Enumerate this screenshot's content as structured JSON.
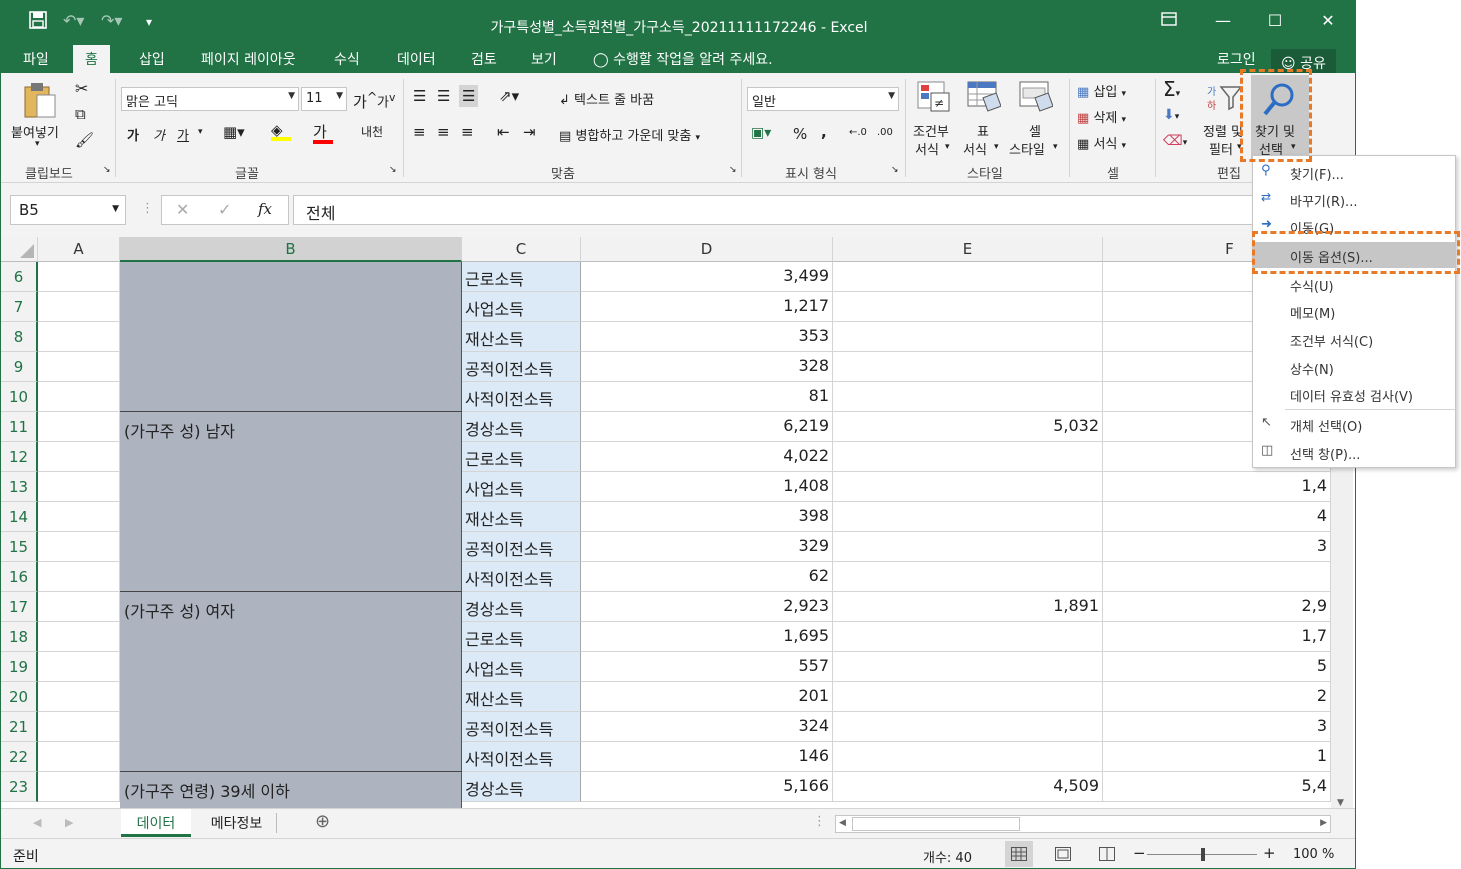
{
  "title": "가구특성별_소득원천별_가구소득_20211111172246 - Excel",
  "tabs": [
    "파일",
    "홈",
    "삽입",
    "페이지 레이아웃",
    "수식",
    "데이터",
    "검토",
    "보기"
  ],
  "tell_me": "수행할 작업을 알려 주세요.",
  "login": "로그인",
  "share": "공유",
  "ribbon": {
    "paste": "붙여넣기",
    "clipboard": "클립보드",
    "font_name": "맑은 고딕",
    "font_size": "11",
    "font_group": "글꼴",
    "bold": "가",
    "italic": "가",
    "underline": "가",
    "font_color_glyph": "가",
    "phonetic": "내천",
    "wrap_text": "텍스트 줄 바꿈",
    "merge_center": "병합하고 가운데 맞춤",
    "align_group": "맞춤",
    "number_format": "일반",
    "percent": "%",
    "comma": ",",
    "number_group": "표시 형식",
    "cond_format_1": "조건부",
    "cond_format_2": "서식",
    "table_format_1": "표",
    "table_format_2": "서식",
    "cell_style_1": "셀",
    "cell_style_2": "스타일",
    "styles_group": "스타일",
    "insert": "삽입",
    "delete": "삭제",
    "format": "서식",
    "cells_group": "셀",
    "sort_filter_1": "정렬 및",
    "sort_filter_2": "필터",
    "find_select_1": "찾기 및",
    "find_select_2": "선택",
    "editing_group": "편집"
  },
  "name_box": "B5",
  "formula": "전체",
  "columns": [
    "A",
    "B",
    "C",
    "D",
    "E",
    "F"
  ],
  "rows": [
    {
      "n": "6",
      "c": "근로소득",
      "d": "3,499",
      "e": "",
      "f": ""
    },
    {
      "n": "7",
      "c": "사업소득",
      "d": "1,217",
      "e": "",
      "f": ""
    },
    {
      "n": "8",
      "c": "재산소득",
      "d": "353",
      "e": "",
      "f": ""
    },
    {
      "n": "9",
      "c": "공적이전소득",
      "d": "328",
      "e": "",
      "f": ""
    },
    {
      "n": "10",
      "c": "사적이전소득",
      "d": "81",
      "e": "",
      "f": ""
    },
    {
      "n": "11",
      "c": "경상소득",
      "d": "6,219",
      "e": "5,032",
      "f": ""
    },
    {
      "n": "12",
      "c": "근로소득",
      "d": "4,022",
      "e": "",
      "f": ""
    },
    {
      "n": "13",
      "c": "사업소득",
      "d": "1,408",
      "e": "",
      "f": "1,4"
    },
    {
      "n": "14",
      "c": "재산소득",
      "d": "398",
      "e": "",
      "f": "4"
    },
    {
      "n": "15",
      "c": "공적이전소득",
      "d": "329",
      "e": "",
      "f": "3"
    },
    {
      "n": "16",
      "c": "사적이전소득",
      "d": "62",
      "e": "",
      "f": ""
    },
    {
      "n": "17",
      "c": "경상소득",
      "d": "2,923",
      "e": "1,891",
      "f": "2,9"
    },
    {
      "n": "18",
      "c": "근로소득",
      "d": "1,695",
      "e": "",
      "f": "1,7"
    },
    {
      "n": "19",
      "c": "사업소득",
      "d": "557",
      "e": "",
      "f": "5"
    },
    {
      "n": "20",
      "c": "재산소득",
      "d": "201",
      "e": "",
      "f": "2"
    },
    {
      "n": "21",
      "c": "공적이전소득",
      "d": "324",
      "e": "",
      "f": "3"
    },
    {
      "n": "22",
      "c": "사적이전소득",
      "d": "146",
      "e": "",
      "f": "1"
    },
    {
      "n": "23",
      "c": "경상소득",
      "d": "5,166",
      "e": "4,509",
      "f": "5,4"
    }
  ],
  "b_groups": [
    "",
    "(가구주 성) 남자",
    "(가구주 성) 여자",
    "(가구주 연령) 39세 이하"
  ],
  "sheets": [
    "데이터",
    "메타정보"
  ],
  "status": {
    "ready": "준비",
    "count": "개수: 40",
    "zoom": "100 %"
  },
  "menu": [
    "찾기(F)...",
    "바꾸기(R)...",
    "이동(G)...",
    "이동 옵션(S)...",
    "수식(U)",
    "메모(M)",
    "조건부 서식(C)",
    "상수(N)",
    "데이터 유효성 검사(V)",
    "개체 선택(O)",
    "선택 창(P)..."
  ],
  "colors": {
    "accent": "#217346",
    "highlight": "#e87a27",
    "selection": "#adb4bf"
  }
}
